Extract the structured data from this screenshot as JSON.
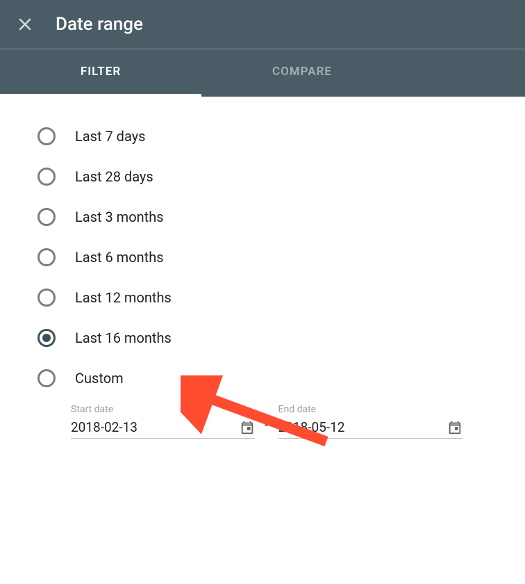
{
  "header": {
    "title": "Date range",
    "tabs": [
      {
        "label": "FILTER",
        "active": true
      },
      {
        "label": "COMPARE",
        "active": false
      }
    ]
  },
  "options": [
    {
      "label": "Last 7 days",
      "selected": false
    },
    {
      "label": "Last 28 days",
      "selected": false
    },
    {
      "label": "Last 3 months",
      "selected": false
    },
    {
      "label": "Last 6 months",
      "selected": false
    },
    {
      "label": "Last 12 months",
      "selected": false
    },
    {
      "label": "Last 16 months",
      "selected": true
    },
    {
      "label": "Custom",
      "selected": false
    }
  ],
  "dates": {
    "start": {
      "label": "Start date",
      "value": "2018-02-13"
    },
    "end": {
      "label": "End date",
      "value": "2018-05-12"
    },
    "separator": "-"
  },
  "annotation": {
    "arrow_color": "#ff4b30"
  }
}
